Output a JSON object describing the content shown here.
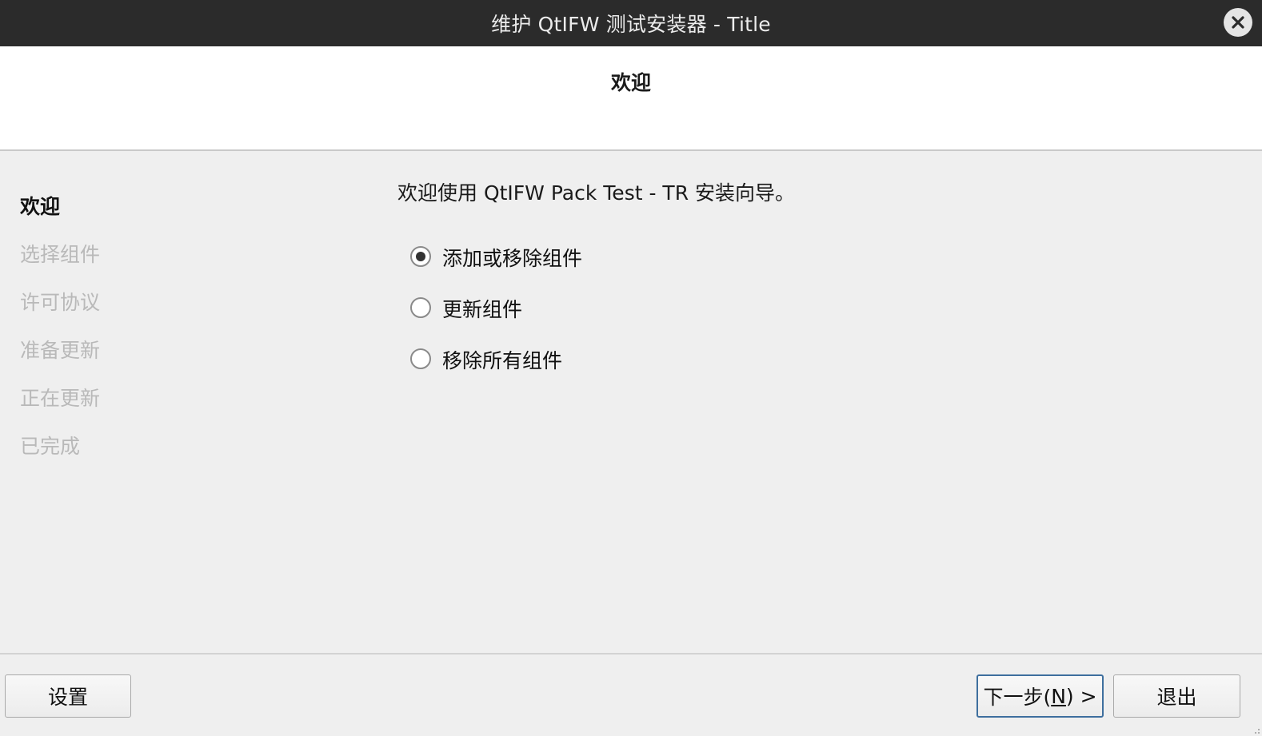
{
  "window": {
    "title": "维护 QtIFW 测试安装器 - Title"
  },
  "header": {
    "title": "欢迎"
  },
  "sidebar": {
    "steps": [
      {
        "label": "欢迎",
        "active": true
      },
      {
        "label": "选择组件",
        "active": false
      },
      {
        "label": "许可协议",
        "active": false
      },
      {
        "label": "准备更新",
        "active": false
      },
      {
        "label": "正在更新",
        "active": false
      },
      {
        "label": "已完成",
        "active": false
      }
    ]
  },
  "main": {
    "intro": "欢迎使用 QtIFW Pack Test - TR 安装向导。",
    "options": [
      {
        "label": "添加或移除组件",
        "selected": true
      },
      {
        "label": "更新组件",
        "selected": false
      },
      {
        "label": "移除所有组件",
        "selected": false
      }
    ]
  },
  "footer": {
    "settings_label": "设置",
    "next_label_prefix": "下一步(",
    "next_label_mnemonic": "N",
    "next_label_suffix": ") >",
    "quit_label": "退出"
  },
  "icons": {
    "close": "close-icon",
    "grip": "resize-grip-icon"
  },
  "colors": {
    "titlebar_bg": "#2b2b2b",
    "primary_border": "#3e6f9e",
    "inactive_step": "#b9b9b9"
  }
}
